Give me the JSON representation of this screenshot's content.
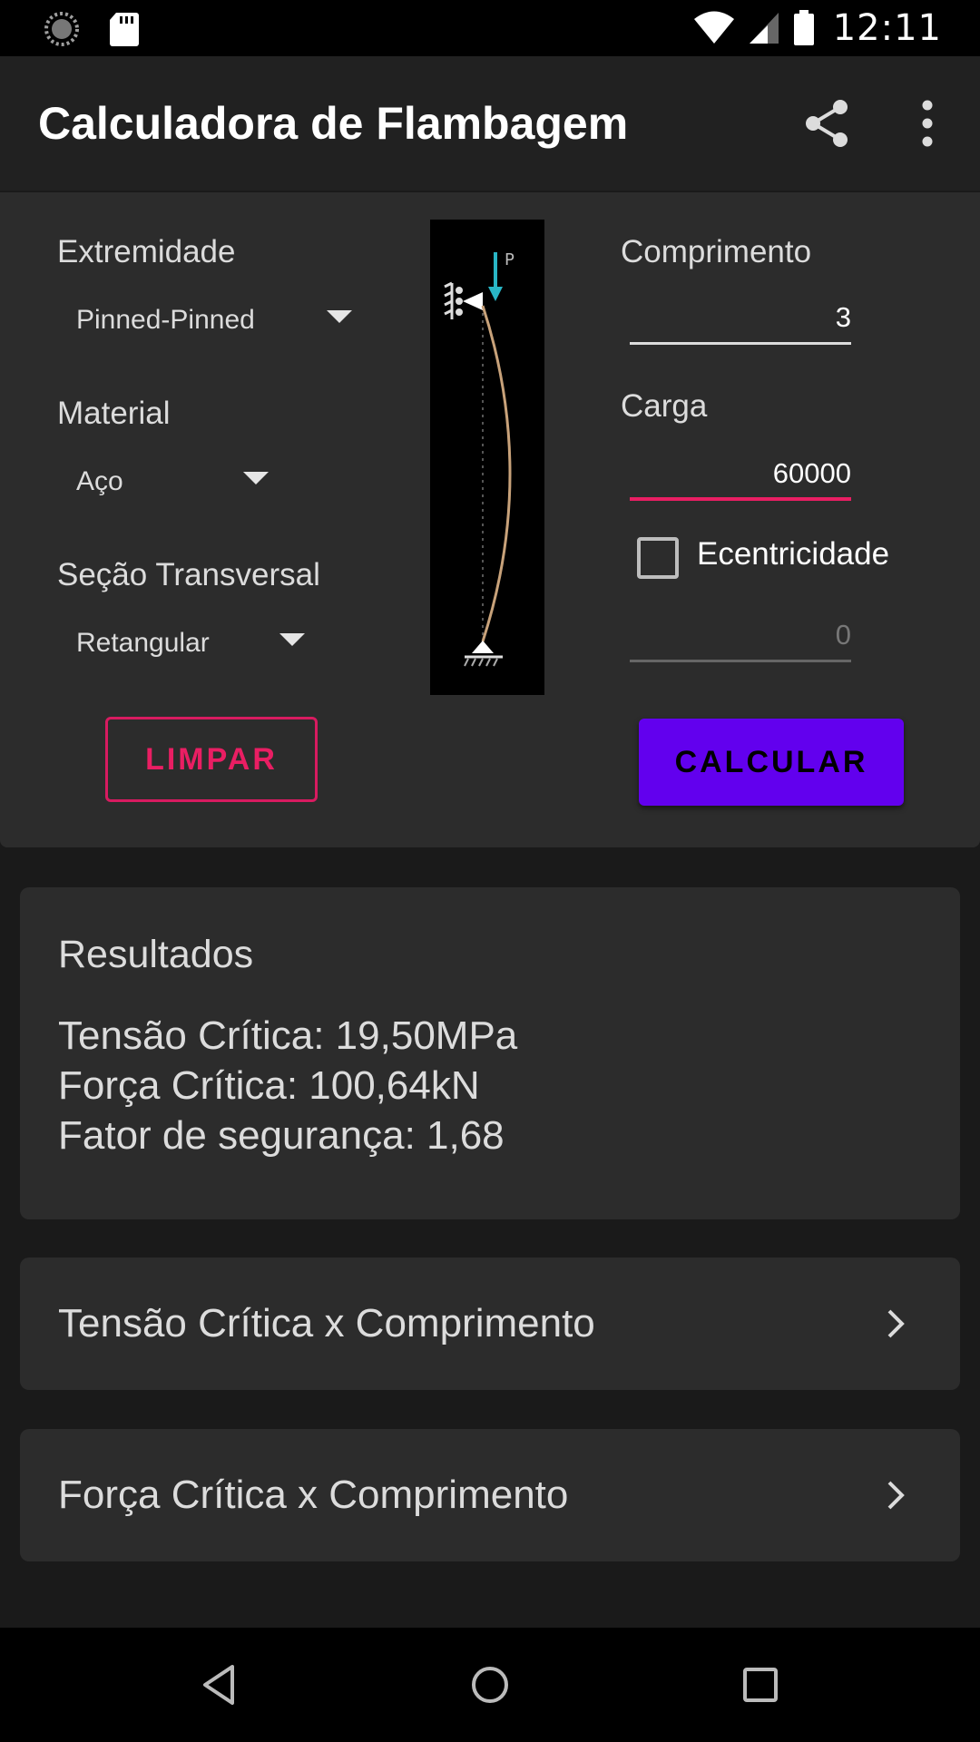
{
  "status_bar": {
    "time": "12:11",
    "icons": [
      "loading-icon",
      "sd-card-icon",
      "wifi-icon",
      "signal-icon",
      "battery-icon"
    ]
  },
  "app_bar": {
    "title": "Calculadora de Flambagem",
    "actions": [
      "share-icon",
      "more-vert-icon"
    ]
  },
  "form": {
    "extremidade": {
      "label": "Extremidade",
      "value": "Pinned-Pinned"
    },
    "material": {
      "label": "Material",
      "value": "Aço"
    },
    "secao": {
      "label": "Seção Transversal",
      "value": "Retangular"
    },
    "comprimento": {
      "label": "Comprimento",
      "value": "3"
    },
    "carga": {
      "label": "Carga",
      "value": "60000"
    },
    "ecentricidade": {
      "label": "Ecentricidade",
      "checked": false,
      "value": "0"
    },
    "diagram": {
      "load_label": "P"
    },
    "buttons": {
      "limpar": "LIMPAR",
      "calcular": "CALCULAR"
    }
  },
  "results": {
    "title": "Resultados",
    "tensao": "Tensão Crítica: 19,50MPa",
    "forca": "Força Crítica: 100,64kN",
    "fator": "Fator de segurança: 1,68"
  },
  "links": [
    {
      "label": "Tensão Crítica x Comprimento"
    },
    {
      "label": "Força Crítica x Comprimento"
    }
  ],
  "colors": {
    "accent": "#e91e63",
    "primary": "#6200ee",
    "background": "#1a1a1a",
    "card": "#2c2c2c"
  },
  "nav_bar": [
    "back-icon",
    "home-icon",
    "recents-icon"
  ]
}
